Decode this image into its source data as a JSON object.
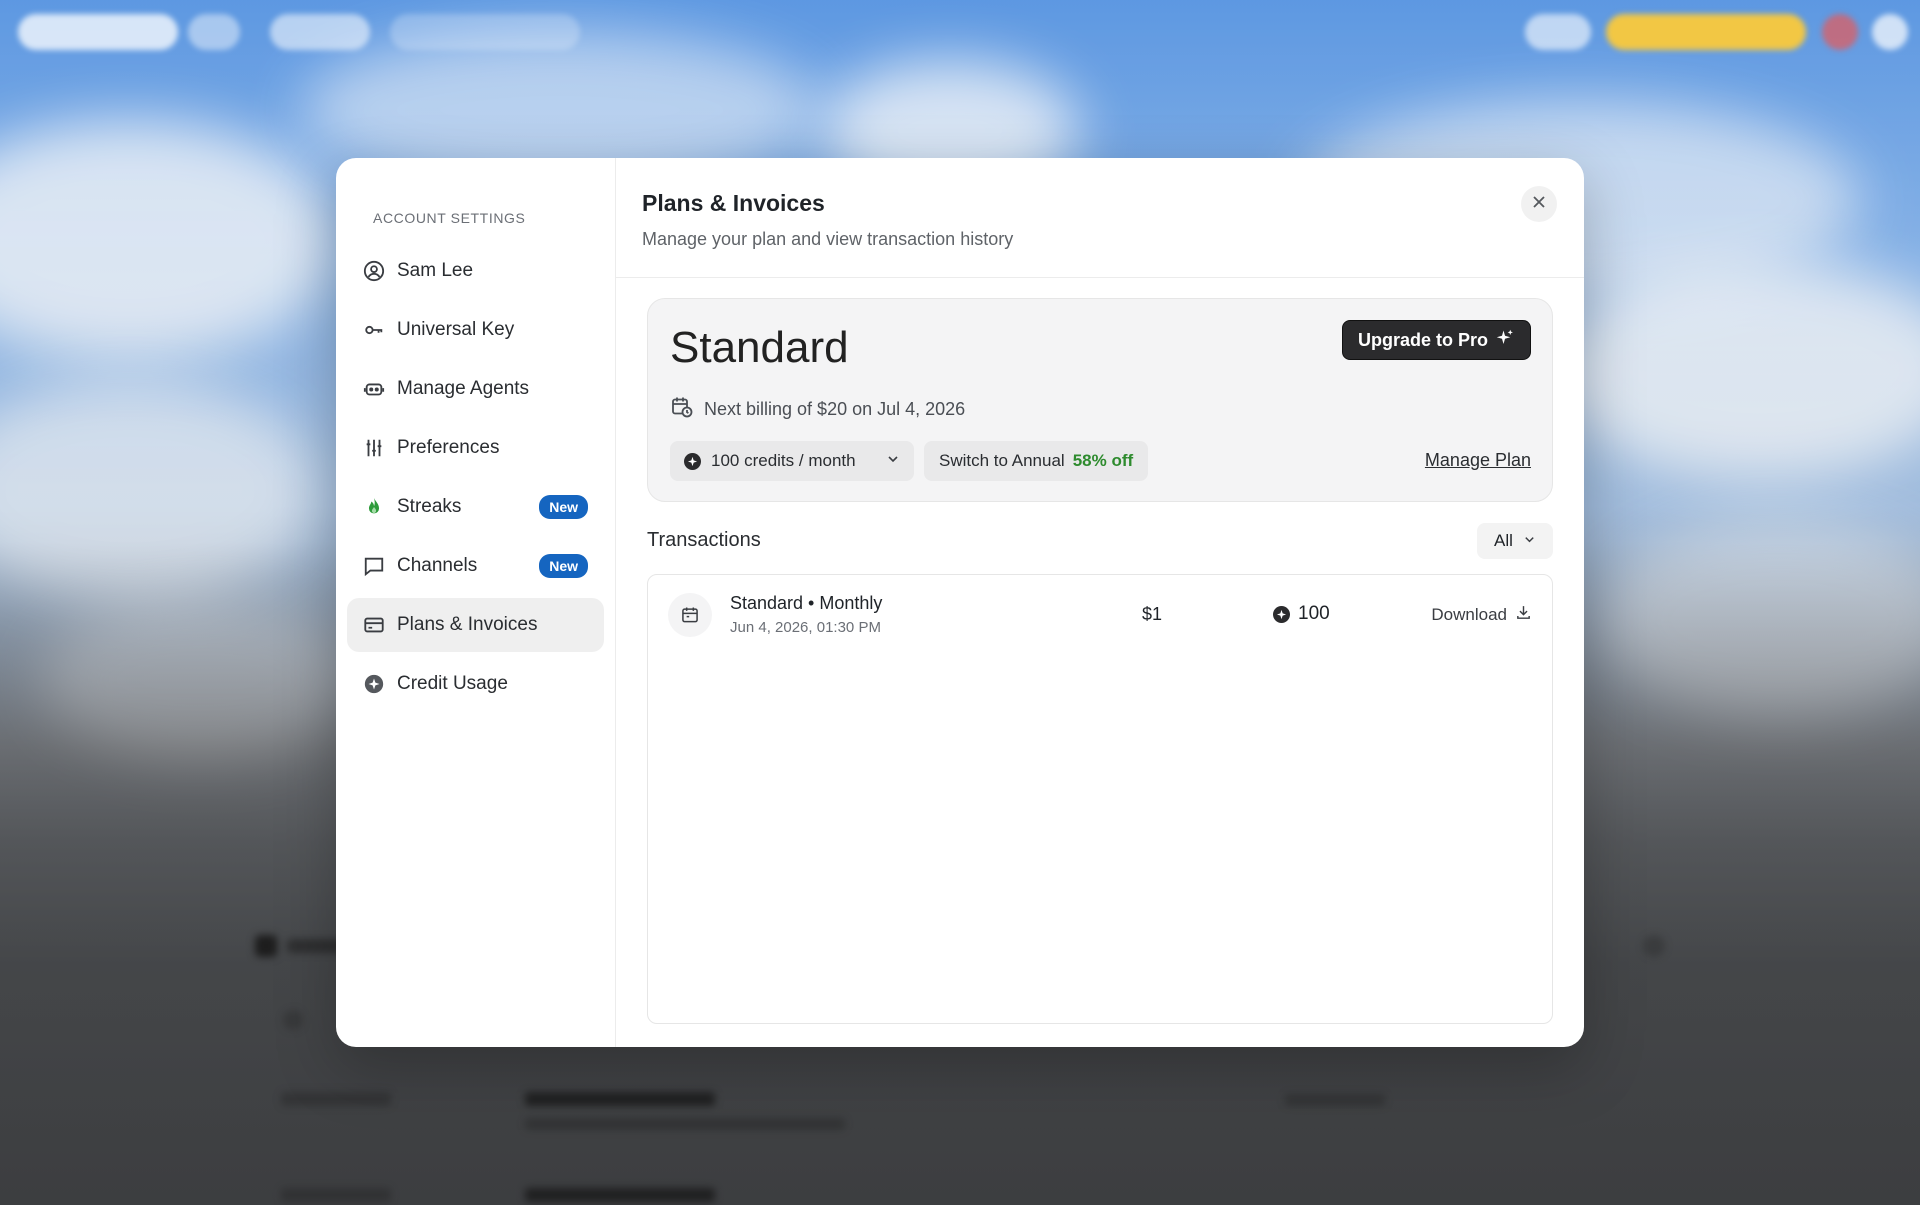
{
  "modal": {
    "sidebar": {
      "heading": "ACCOUNT SETTINGS",
      "items": [
        {
          "label": "Sam Lee",
          "icon": "user-circle-icon"
        },
        {
          "label": "Universal Key",
          "icon": "key-icon"
        },
        {
          "label": "Manage Agents",
          "icon": "robot-icon"
        },
        {
          "label": "Preferences",
          "icon": "sliders-icon"
        },
        {
          "label": "Streaks",
          "icon": "flame-icon",
          "badge": "New"
        },
        {
          "label": "Channels",
          "icon": "chat-bubble-icon",
          "badge": "New"
        },
        {
          "label": "Plans & Invoices",
          "icon": "credit-card-icon",
          "active": true
        },
        {
          "label": "Credit Usage",
          "icon": "credit-coin-icon"
        }
      ]
    },
    "header": {
      "title": "Plans & Invoices",
      "subtitle": "Manage your plan and view transaction history"
    },
    "plan": {
      "name": "Standard",
      "upgrade_label": "Upgrade to Pro",
      "billing_text": "Next billing of $20 on Jul 4, 2026",
      "credits_option": "100 credits / month",
      "switch_label": "Switch to Annual",
      "discount": "58% off",
      "manage_label": "Manage Plan"
    },
    "transactions": {
      "title": "Transactions",
      "filter_value": "All",
      "rows": [
        {
          "name": "Standard • Monthly",
          "date": "Jun 4, 2026, 01:30 PM",
          "amount": "$1",
          "credits": "100",
          "download_label": "Download"
        }
      ]
    }
  },
  "colors": {
    "accent_badge": "#1565c0",
    "discount_green": "#2e8b2e",
    "streak_flame": "#2e9b3a",
    "dark_button": "#2b2b2d"
  }
}
